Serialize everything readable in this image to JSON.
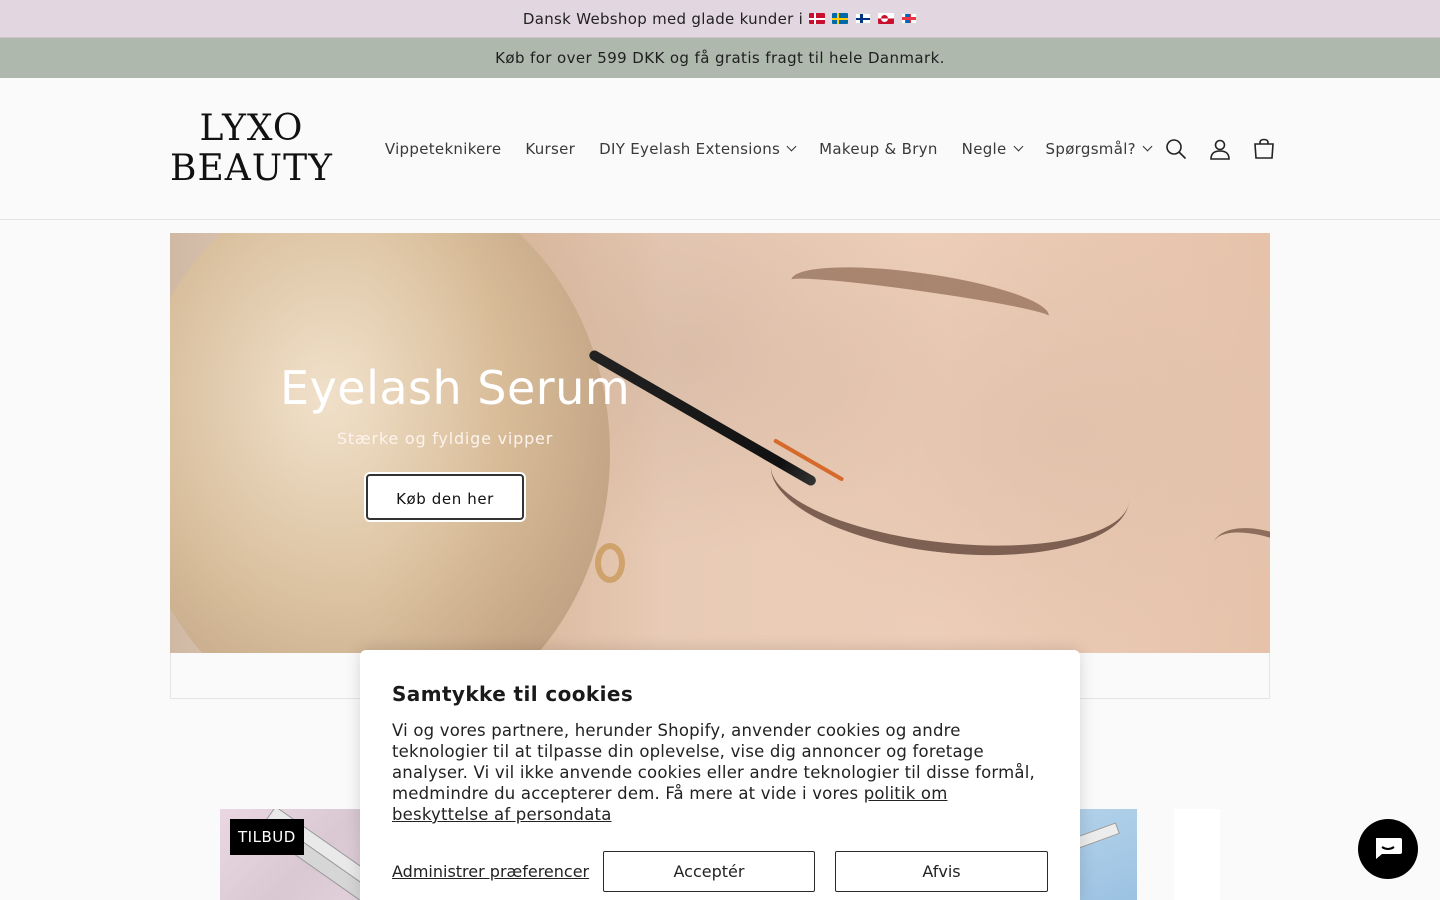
{
  "announcement_top": {
    "text": "Dansk Webshop med glade kunder i",
    "flags": [
      "dk-flag",
      "se-flag",
      "fi-flag",
      "gl-flag",
      "fo-flag"
    ]
  },
  "announcement_shipping": {
    "text": "Køb for over 599 DKK og få gratis fragt til hele Danmark."
  },
  "header": {
    "logo_line1": "LYXO",
    "logo_line2": "BEAUTY",
    "nav": [
      {
        "label": "Vippeteknikere",
        "dropdown": false
      },
      {
        "label": "Kurser",
        "dropdown": false
      },
      {
        "label": "DIY Eyelash Extensions",
        "dropdown": true
      },
      {
        "label": "Makeup & Bryn",
        "dropdown": false
      },
      {
        "label": "Negle",
        "dropdown": true
      },
      {
        "label": "Spørgsmål?",
        "dropdown": true
      }
    ],
    "icons": [
      "search-icon",
      "account-icon",
      "cart-icon"
    ]
  },
  "hero": {
    "title": "Eyelash Serum",
    "subtitle": "Stærke og fyldige vipper",
    "button_label": "Køb den her"
  },
  "products": {
    "badge": "TILBUD"
  },
  "cookie_banner": {
    "title": "Samtykke til cookies",
    "text": "Vi og vores partnere, herunder Shopify, anvender cookies og andre teknologier til at tilpasse din oplevelse, vise dig annoncer og foretage analyser. Vi vil ikke anvende cookies eller andre teknologier til disse formål, medmindre du accepterer dem. Få mere at vide i vores",
    "link_text": "politik om beskyttelse af persondata",
    "manage_label": "Administrer præferencer",
    "accept_label": "Acceptér",
    "decline_label": "Afvis"
  },
  "chat": {
    "icon": "chat-icon"
  },
  "colors": {
    "announce_top_bg": "#e2d7e0",
    "announce_shipping_bg": "#aeb8ad",
    "page_bg": "#fafafa",
    "chat_bg": "#000000"
  }
}
